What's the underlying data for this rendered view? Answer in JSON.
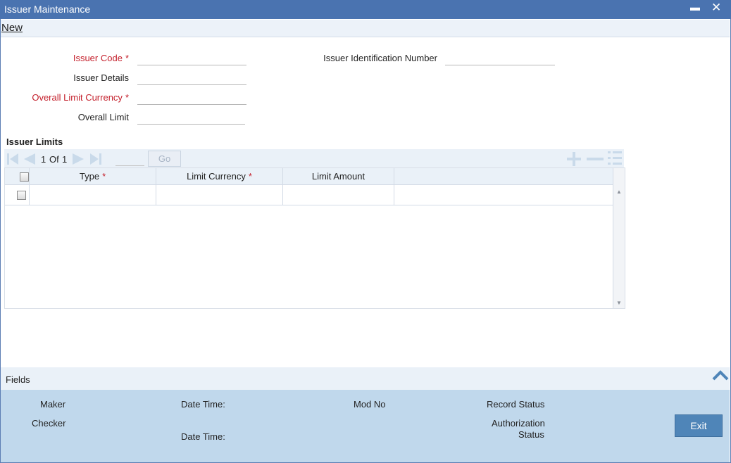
{
  "window": {
    "title": "Issuer Maintenance",
    "minimize": "▬",
    "close": "✕"
  },
  "menu": {
    "new_label": "New"
  },
  "form": {
    "issuer_code_label": "Issuer Code",
    "issuer_code_value": "",
    "issuer_details_label": "Issuer Details",
    "issuer_details_value": "",
    "overall_limit_currency_label": "Overall Limit Currency",
    "overall_limit_currency_value": "",
    "overall_limit_label": "Overall Limit",
    "overall_limit_value": "",
    "issuer_id_number_label": "Issuer Identification Number",
    "issuer_id_number_value": "",
    "required_mark": "*"
  },
  "issuer_limits": {
    "title": "Issuer Limits",
    "pager": {
      "current": "1",
      "of_label": "Of",
      "total": "1",
      "go_label": "Go"
    },
    "columns": [
      "Type",
      "Limit Currency",
      "Limit Amount"
    ],
    "rows": [
      {
        "type": "",
        "limit_currency": "",
        "limit_amount": ""
      }
    ]
  },
  "fields_bar": {
    "label": "Fields"
  },
  "footer": {
    "maker_label": "Maker",
    "checker_label": "Checker",
    "date_time_label_1": "Date Time:",
    "date_time_label_2": "Date Time:",
    "mod_no_label": "Mod No",
    "record_status_label": "Record Status",
    "authorization_label_line1": "Authorization",
    "authorization_label_line2": "Status",
    "exit_label": "Exit"
  },
  "colors": {
    "titlebar": "#4a73b0",
    "required": "#c4202c",
    "footer": "#c0d8ec",
    "exit_button": "#4f85b8"
  },
  "icons": [
    "first-page-icon",
    "prev-page-icon",
    "next-page-icon",
    "last-page-icon",
    "add-row-icon",
    "delete-row-icon",
    "single-record-view-icon",
    "collapse-up-icon"
  ]
}
